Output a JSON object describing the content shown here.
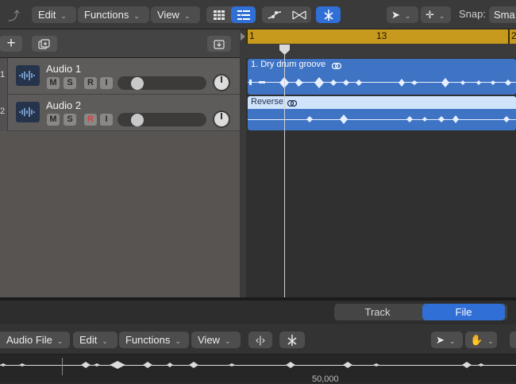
{
  "toolbar": {
    "menus": [
      "Edit",
      "Functions",
      "View"
    ],
    "snap_label": "Snap:",
    "snap_value": "Sma"
  },
  "ruler": {
    "markers": [
      "1",
      "13",
      "2"
    ]
  },
  "tracks": [
    {
      "number": "1",
      "name": "Audio 1",
      "buttons": [
        "M",
        "S",
        "R",
        "I"
      ],
      "record_armed": false
    },
    {
      "number": "2",
      "name": "Audio 2",
      "buttons": [
        "M",
        "S",
        "R",
        "I"
      ],
      "record_armed": true
    }
  ],
  "regions": [
    {
      "name": "1. Dry drum groove"
    },
    {
      "name": "Reverse"
    }
  ],
  "editor": {
    "tabs": [
      "Track",
      "File"
    ],
    "active_tab": "File",
    "menus": [
      "Audio File",
      "Edit",
      "Functions",
      "View"
    ],
    "ruler_label": "50,000"
  },
  "colors": {
    "accent_blue": "#2f6fd6",
    "ruler_gold": "#c79a1e",
    "region_blue": "#3f73c4",
    "region_light": "#cfe3fb",
    "record_red": "#d64040"
  }
}
